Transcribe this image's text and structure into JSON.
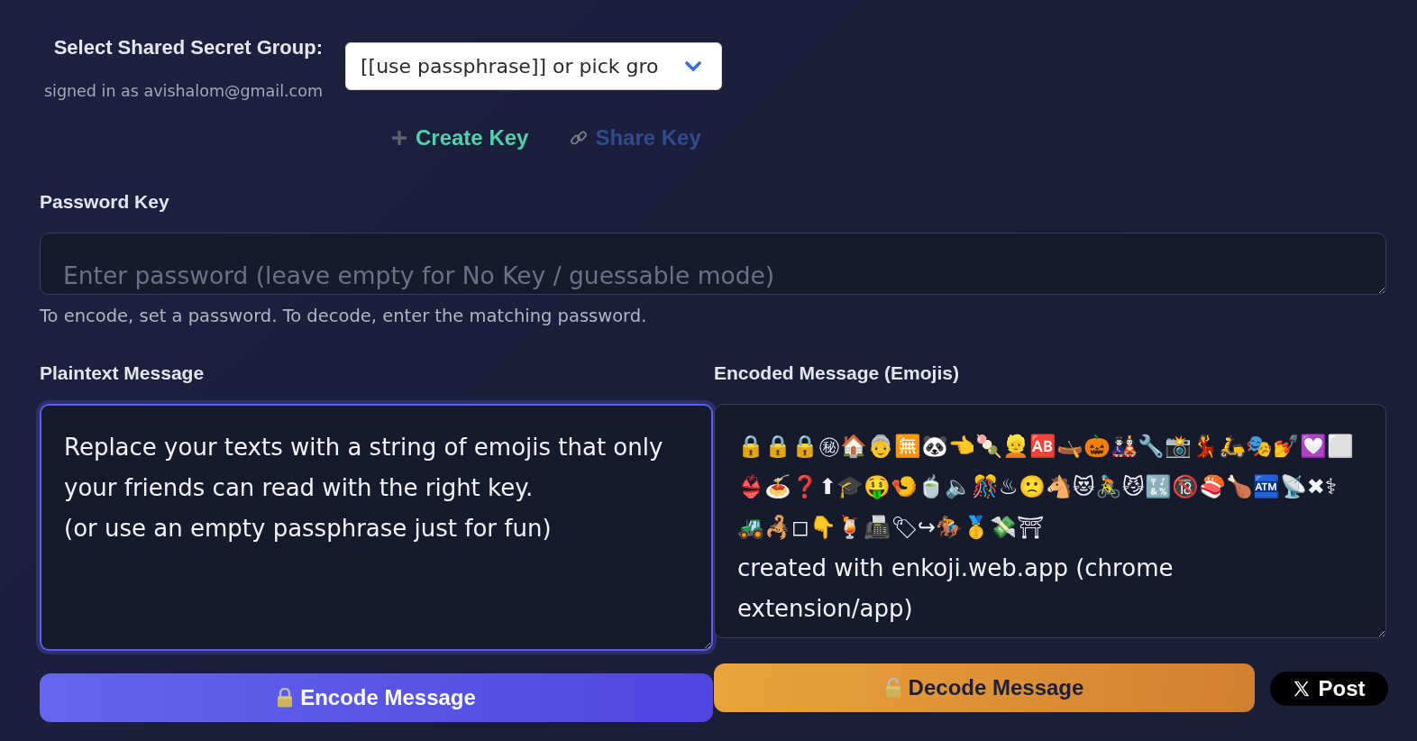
{
  "group_select": {
    "label": "Select Shared Secret Group:",
    "signed_in": "signed in as avishalom@gmail.com",
    "value": "[[use passphrase]] or pick gro"
  },
  "key_actions": [
    {
      "kind": "create",
      "label": "Create Key"
    },
    {
      "kind": "share",
      "label": "Share Key"
    }
  ],
  "password": {
    "label": "Password Key",
    "placeholder": "Enter password (leave empty for No Key / guessable mode)",
    "hint": "To encode, set a password. To decode, enter the matching password."
  },
  "plaintext": {
    "label": "Plaintext Message",
    "value": "Replace your texts with a string of emojis that only your friends can read with the right key.\n(or use an empty passphrase just for fun)",
    "focused": true
  },
  "encoded": {
    "label": "Encoded Message (Emojis)",
    "value": "🔒🔒🔒㊙🏠👵🈚🐼👈🍡👱🆎🛶🎃🎎🔧📸💃🛵🎭💅💟⬜👙🍝❓⬆🎓🤑🍤🍵🔈🎊♨🙁🐴😻🚴😼🔣🔞🍣🍗🏧📡✖⚕🚜🦂◻👇🍹📠🏷↪🏇🥇💸⛩\ncreated with enkoji.web.app (chrome extension/app)",
    "focused": false
  },
  "buttons": [
    {
      "kind": "encode",
      "label": "Encode Message"
    },
    {
      "kind": "decode",
      "label": "Decode Message"
    },
    {
      "kind": "post",
      "label": "Post"
    }
  ]
}
